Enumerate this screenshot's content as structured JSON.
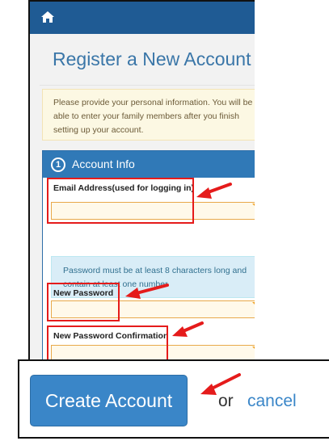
{
  "header": {
    "home_icon": "home-icon",
    "bar_color": "#1f5b94"
  },
  "page": {
    "title": "Register a New Account"
  },
  "notice": {
    "text": "Please provide your personal information. You will be able to enter your family members after you finish setting up your account."
  },
  "account_panel": {
    "step_number": "1",
    "title": "Account Info",
    "email_label": "Email Address(used for logging in)",
    "email_value": "",
    "password_hint": "Password must be at least 8 characters long and contain at least one number",
    "new_password_label": "New Password",
    "new_password_value": "",
    "confirm_password_label": "New Password Confirmation",
    "confirm_password_value": ""
  },
  "actions": {
    "create_label": "Create Account",
    "or_text": "or",
    "cancel_label": "cancel"
  },
  "colors": {
    "primary": "#3079b7",
    "highlight": "#e51b1b",
    "required_flag": "#f0a42a"
  }
}
